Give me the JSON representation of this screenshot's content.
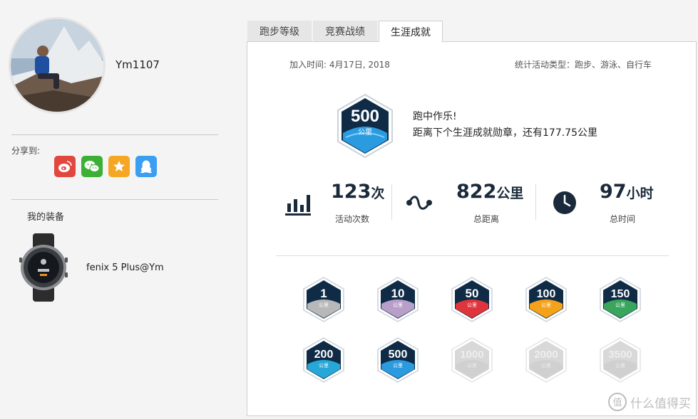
{
  "profile": {
    "username": "Ym1107"
  },
  "share": {
    "label": "分享到:",
    "buttons": [
      {
        "name": "weibo",
        "color": "#e2473d"
      },
      {
        "name": "wechat",
        "color": "#3cb035"
      },
      {
        "name": "qzone",
        "color": "#f5a623"
      },
      {
        "name": "qq",
        "color": "#3b9ef1"
      }
    ]
  },
  "equipment": {
    "label": "我的装备",
    "device_name": "fenix 5 Plus@Ym"
  },
  "tabs": [
    {
      "label": "跑步等级",
      "active": false
    },
    {
      "label": "竞赛战绩",
      "active": false
    },
    {
      "label": "生涯成就",
      "active": true
    }
  ],
  "panel": {
    "join_date": "加入时间: 4月17日, 2018",
    "activity_types": "统计活动类型：跑步、游泳、自行车",
    "current_badge": {
      "value": "500",
      "unit": "公里"
    },
    "message_line1": "跑中作乐!",
    "message_line2": "距离下个生涯成就勋章，还有177.75公里",
    "stats": [
      {
        "value": "123",
        "unit": "次",
        "caption": "活动次数",
        "icon": "bar-chart-icon"
      },
      {
        "value": "822",
        "unit": "公里",
        "caption": "总距离",
        "icon": "route-icon"
      },
      {
        "value": "97",
        "unit": "小时",
        "caption": "总时间",
        "icon": "clock-icon"
      }
    ],
    "badges": [
      {
        "value": "1",
        "unit": "公里",
        "earned": true,
        "accent": "#b8b8b8"
      },
      {
        "value": "10",
        "unit": "公里",
        "earned": true,
        "accent": "#b89fc9"
      },
      {
        "value": "50",
        "unit": "公里",
        "earned": true,
        "accent": "#e0343c"
      },
      {
        "value": "100",
        "unit": "公里",
        "earned": true,
        "accent": "#f4a21b"
      },
      {
        "value": "150",
        "unit": "公里",
        "earned": true,
        "accent": "#3aa55c"
      },
      {
        "value": "200",
        "unit": "公里",
        "earned": true,
        "accent": "#26a7d8"
      },
      {
        "value": "500",
        "unit": "公里",
        "earned": true,
        "accent": "#2b9be0"
      },
      {
        "value": "1000",
        "unit": "公里",
        "earned": false,
        "accent": "#d0d0d0"
      },
      {
        "value": "2000",
        "unit": "公里",
        "earned": false,
        "accent": "#d0d0d0"
      },
      {
        "value": "3500",
        "unit": "公里",
        "earned": false,
        "accent": "#d0d0d0"
      }
    ]
  },
  "watermark": {
    "text": "什么值得买",
    "logo": "值"
  }
}
